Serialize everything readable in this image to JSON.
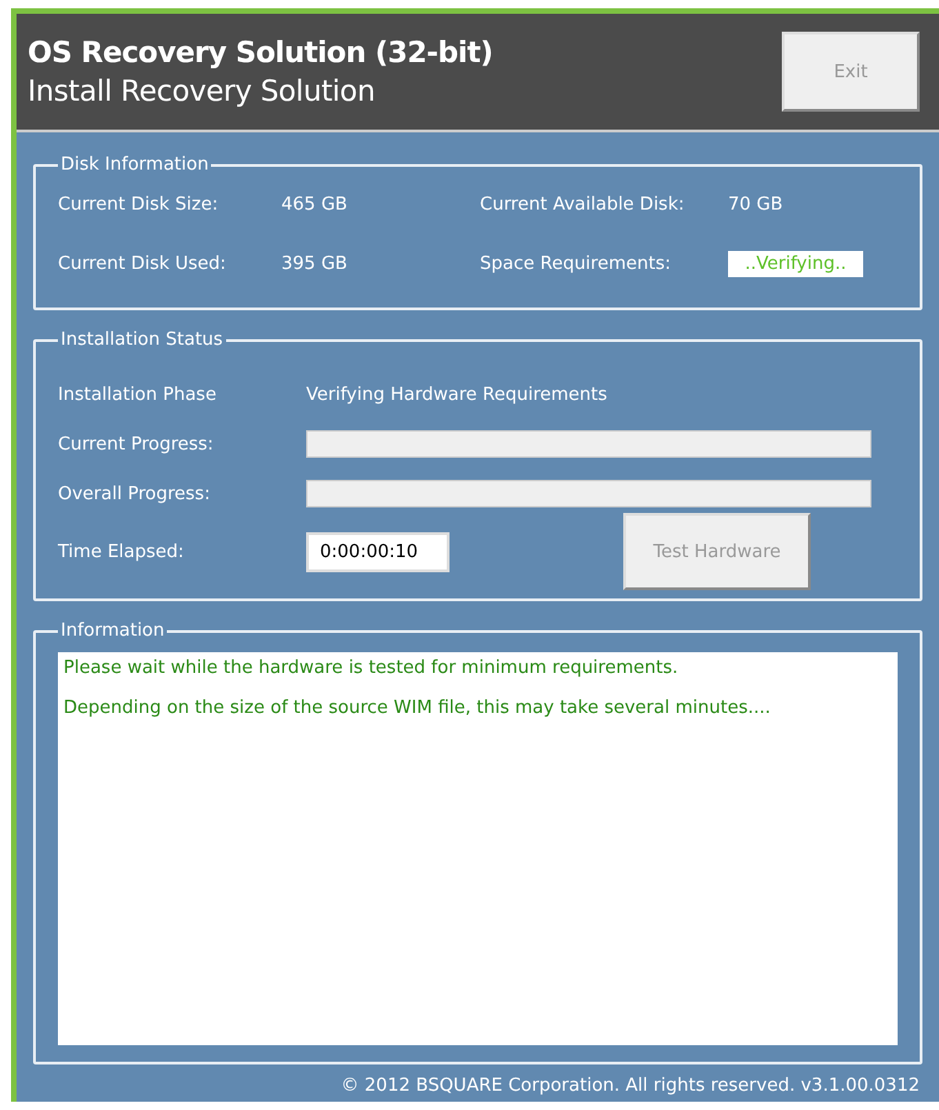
{
  "header": {
    "title": "OS Recovery Solution (32-bit)",
    "subtitle": "Install Recovery Solution",
    "exit_button": {
      "label": "Exit",
      "disabled": true
    }
  },
  "disk_information": {
    "legend": "Disk Information",
    "fields": [
      {
        "label": "Current Disk Size:",
        "value": "465 GB",
        "kind": "text"
      },
      {
        "label": "Current Available Disk:",
        "value": "70 GB",
        "kind": "text"
      },
      {
        "label": "Current Disk Used:",
        "value": "395 GB",
        "kind": "text"
      },
      {
        "label": "Space Requirements:",
        "value": "..Verifying..",
        "kind": "status"
      }
    ]
  },
  "installation_status": {
    "legend": "Installation Status",
    "phase_label": "Installation Phase",
    "phase_value": "Verifying Hardware Requirements",
    "progress": [
      {
        "label": "Current Progress:",
        "level": 0
      },
      {
        "label": "Overall Progress:",
        "level": 0
      }
    ],
    "time_label": "Time Elapsed:",
    "time_value": "0:00:00:10",
    "test_button": {
      "label": "Test Hardware",
      "disabled": true
    }
  },
  "information": {
    "legend": "Information",
    "lines": [
      "Please wait while the hardware is tested for minimum requirements.",
      "Depending on the size of the source WIM file, this may take several minutes...."
    ]
  },
  "footer": "© 2012 BSQUARE Corporation. All rights reserved. v3.1.00.0312"
}
